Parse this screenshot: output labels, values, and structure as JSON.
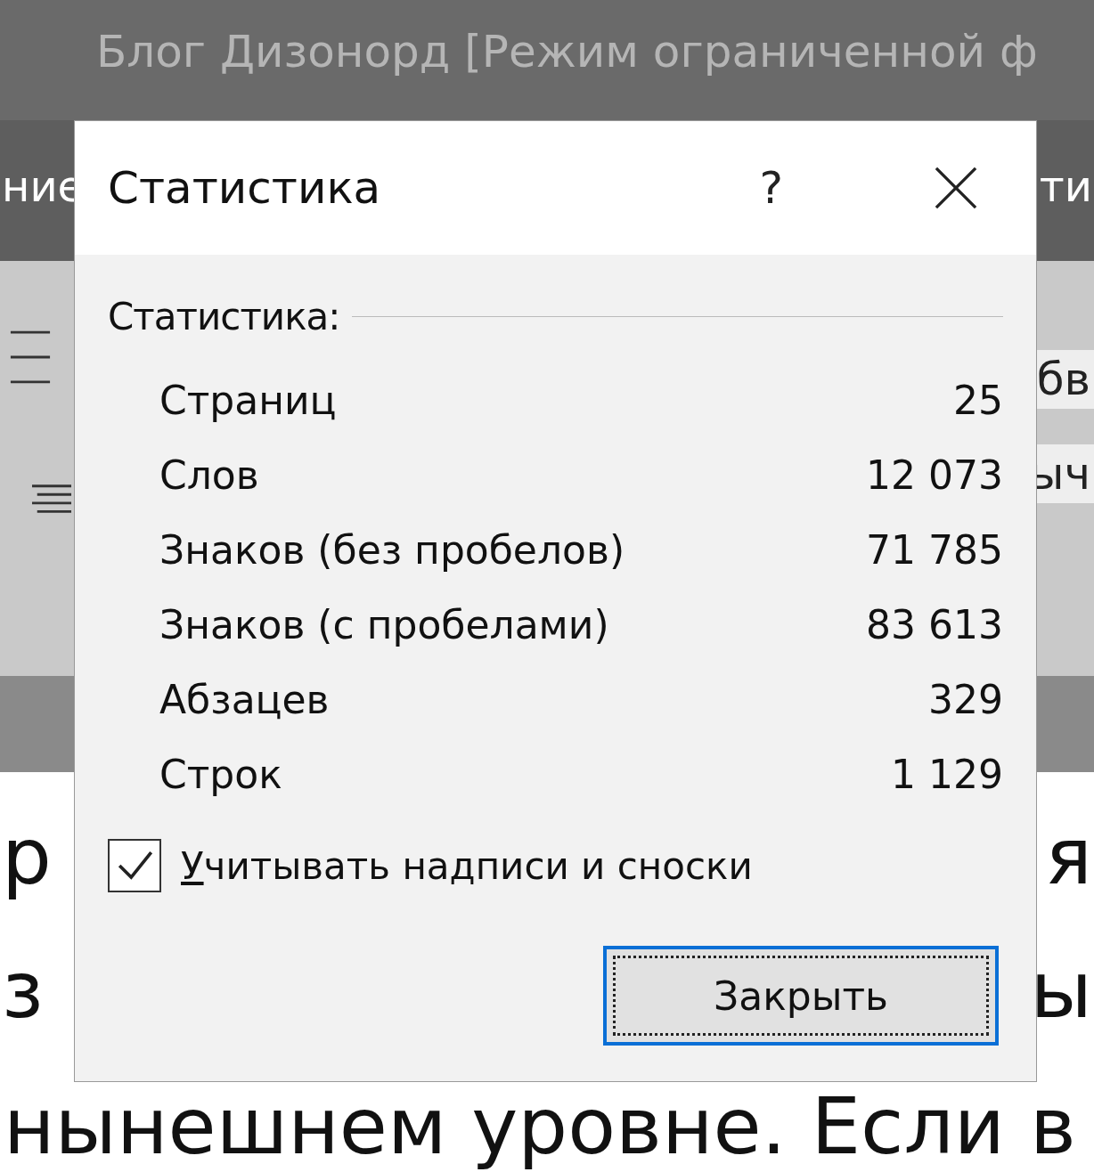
{
  "app": {
    "title": "Блог Дизонорд [Режим ограниченной ф",
    "ribbon_left": "ние",
    "ribbon_right": "ти",
    "ribbon_fragments": [
      "бв",
      "ыч"
    ]
  },
  "document": {
    "lines": [
      {
        "kind": "split",
        "left": "р",
        "right": "я"
      },
      {
        "kind": "split",
        "left": "з",
        "right": "ы"
      },
      {
        "kind": "full",
        "text": "нынешнем уровне. Если в"
      }
    ]
  },
  "dialog": {
    "title": "Статистика",
    "help": "?",
    "group_label": "Статистика:",
    "stats": [
      {
        "label": "Страниц",
        "value": "25"
      },
      {
        "label": "Слов",
        "value": "12 073"
      },
      {
        "label": "Знаков (без пробелов)",
        "value": "71 785"
      },
      {
        "label": "Знаков (с пробелами)",
        "value": "83 613"
      },
      {
        "label": "Абзацев",
        "value": "329"
      },
      {
        "label": "Строк",
        "value": "1 129"
      }
    ],
    "checkbox": {
      "label": "Учитывать надписи и сноски",
      "checked": true
    },
    "button": {
      "label": "Закрыть",
      "focused": true
    }
  }
}
